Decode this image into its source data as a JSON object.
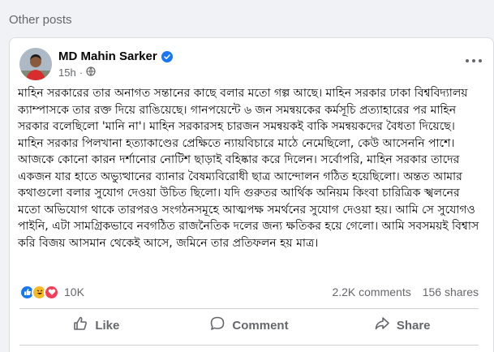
{
  "section": {
    "title": "Other posts"
  },
  "post": {
    "author": "MD Mahin Sarker",
    "verified": true,
    "time": "15h",
    "separator": "·",
    "icons": {
      "verified": "verified-badge-icon",
      "privacy": "globe-icon",
      "more": "more-options-icon"
    },
    "text": "মাহিন সরকারের তার অনাগত সন্তানের কাছে বলার মতো গল্প আছে। মাহিন সরকার ঢাকা বিশ্ববিদ্যালয় ক্যাম্পাসকে তার রক্ত দিয়ে রাঙিয়েছে। গানপয়েন্টে ৬ জন সমন্বয়কের কর্মসূচি প্রত্যাহারের পর মাহিন সরকার বলেছিলো 'মানি না'। মাহিন সরকারসহ চারজন সমন্বয়কই বাকি সমন্বয়কদের বৈধতা দিয়েছে। মাহিন সরকার পিলখানা হত্যাকাণ্ডের প্রেক্ষিতে ন্যায়বিচারে মাঠে নেমেছিলো, কেউ আসেননি পাশে। আজকে কোনো কারন দর্শানোর নোটিশ ছাড়াই বহিষ্কার করে দিলেন। সর্বোপরি, মাহিন সরকার তাদের একজন যার হাতে অভ্যুত্থানের ব্যানার বৈষম্যবিরোধী ছাত্র আন্দোলন গঠিত হয়েছিলো। অন্তত আমার কথাগুলো বলার সুযোগ দেওয়া উচিত ছিলো। যদি গুরুতর আর্থিক অনিয়ম কিংবা চারিত্রিক স্খলনের মতো অভিযোগ থাকে তারপরও সংগঠনসমূহে আত্মপক্ষ সমর্থনের সুযোগ দেওয়া হয়। আমি সে সুযোগও পাইনি, এটা সামগ্রিকভাবে নবগঠিত রাজনৈতিক দলের জন্য ক্ষতিকর হয়ে গেলো। আমি সবসময়ই বিশ্বাস করি বিজয় আসমান থেকেই আসে, জমিনে তার প্রতিফলন হয় মাত্র।",
    "reactions": {
      "icons": [
        "like-reaction-icon",
        "haha-reaction-icon",
        "love-reaction-icon"
      ],
      "count": "10K"
    },
    "comments": "2.2K comments",
    "shares": "156 shares",
    "actions": [
      {
        "label": "Like",
        "icon": "thumbs-up-icon"
      },
      {
        "label": "Comment",
        "icon": "comment-icon"
      },
      {
        "label": "Share",
        "icon": "share-icon"
      }
    ]
  },
  "colors": {
    "accent": "#1877f2",
    "background": "#f0f2f5",
    "muted": "#65676b",
    "like": "#1877f2",
    "haha": "#f7b928",
    "love": "#f33e58"
  }
}
